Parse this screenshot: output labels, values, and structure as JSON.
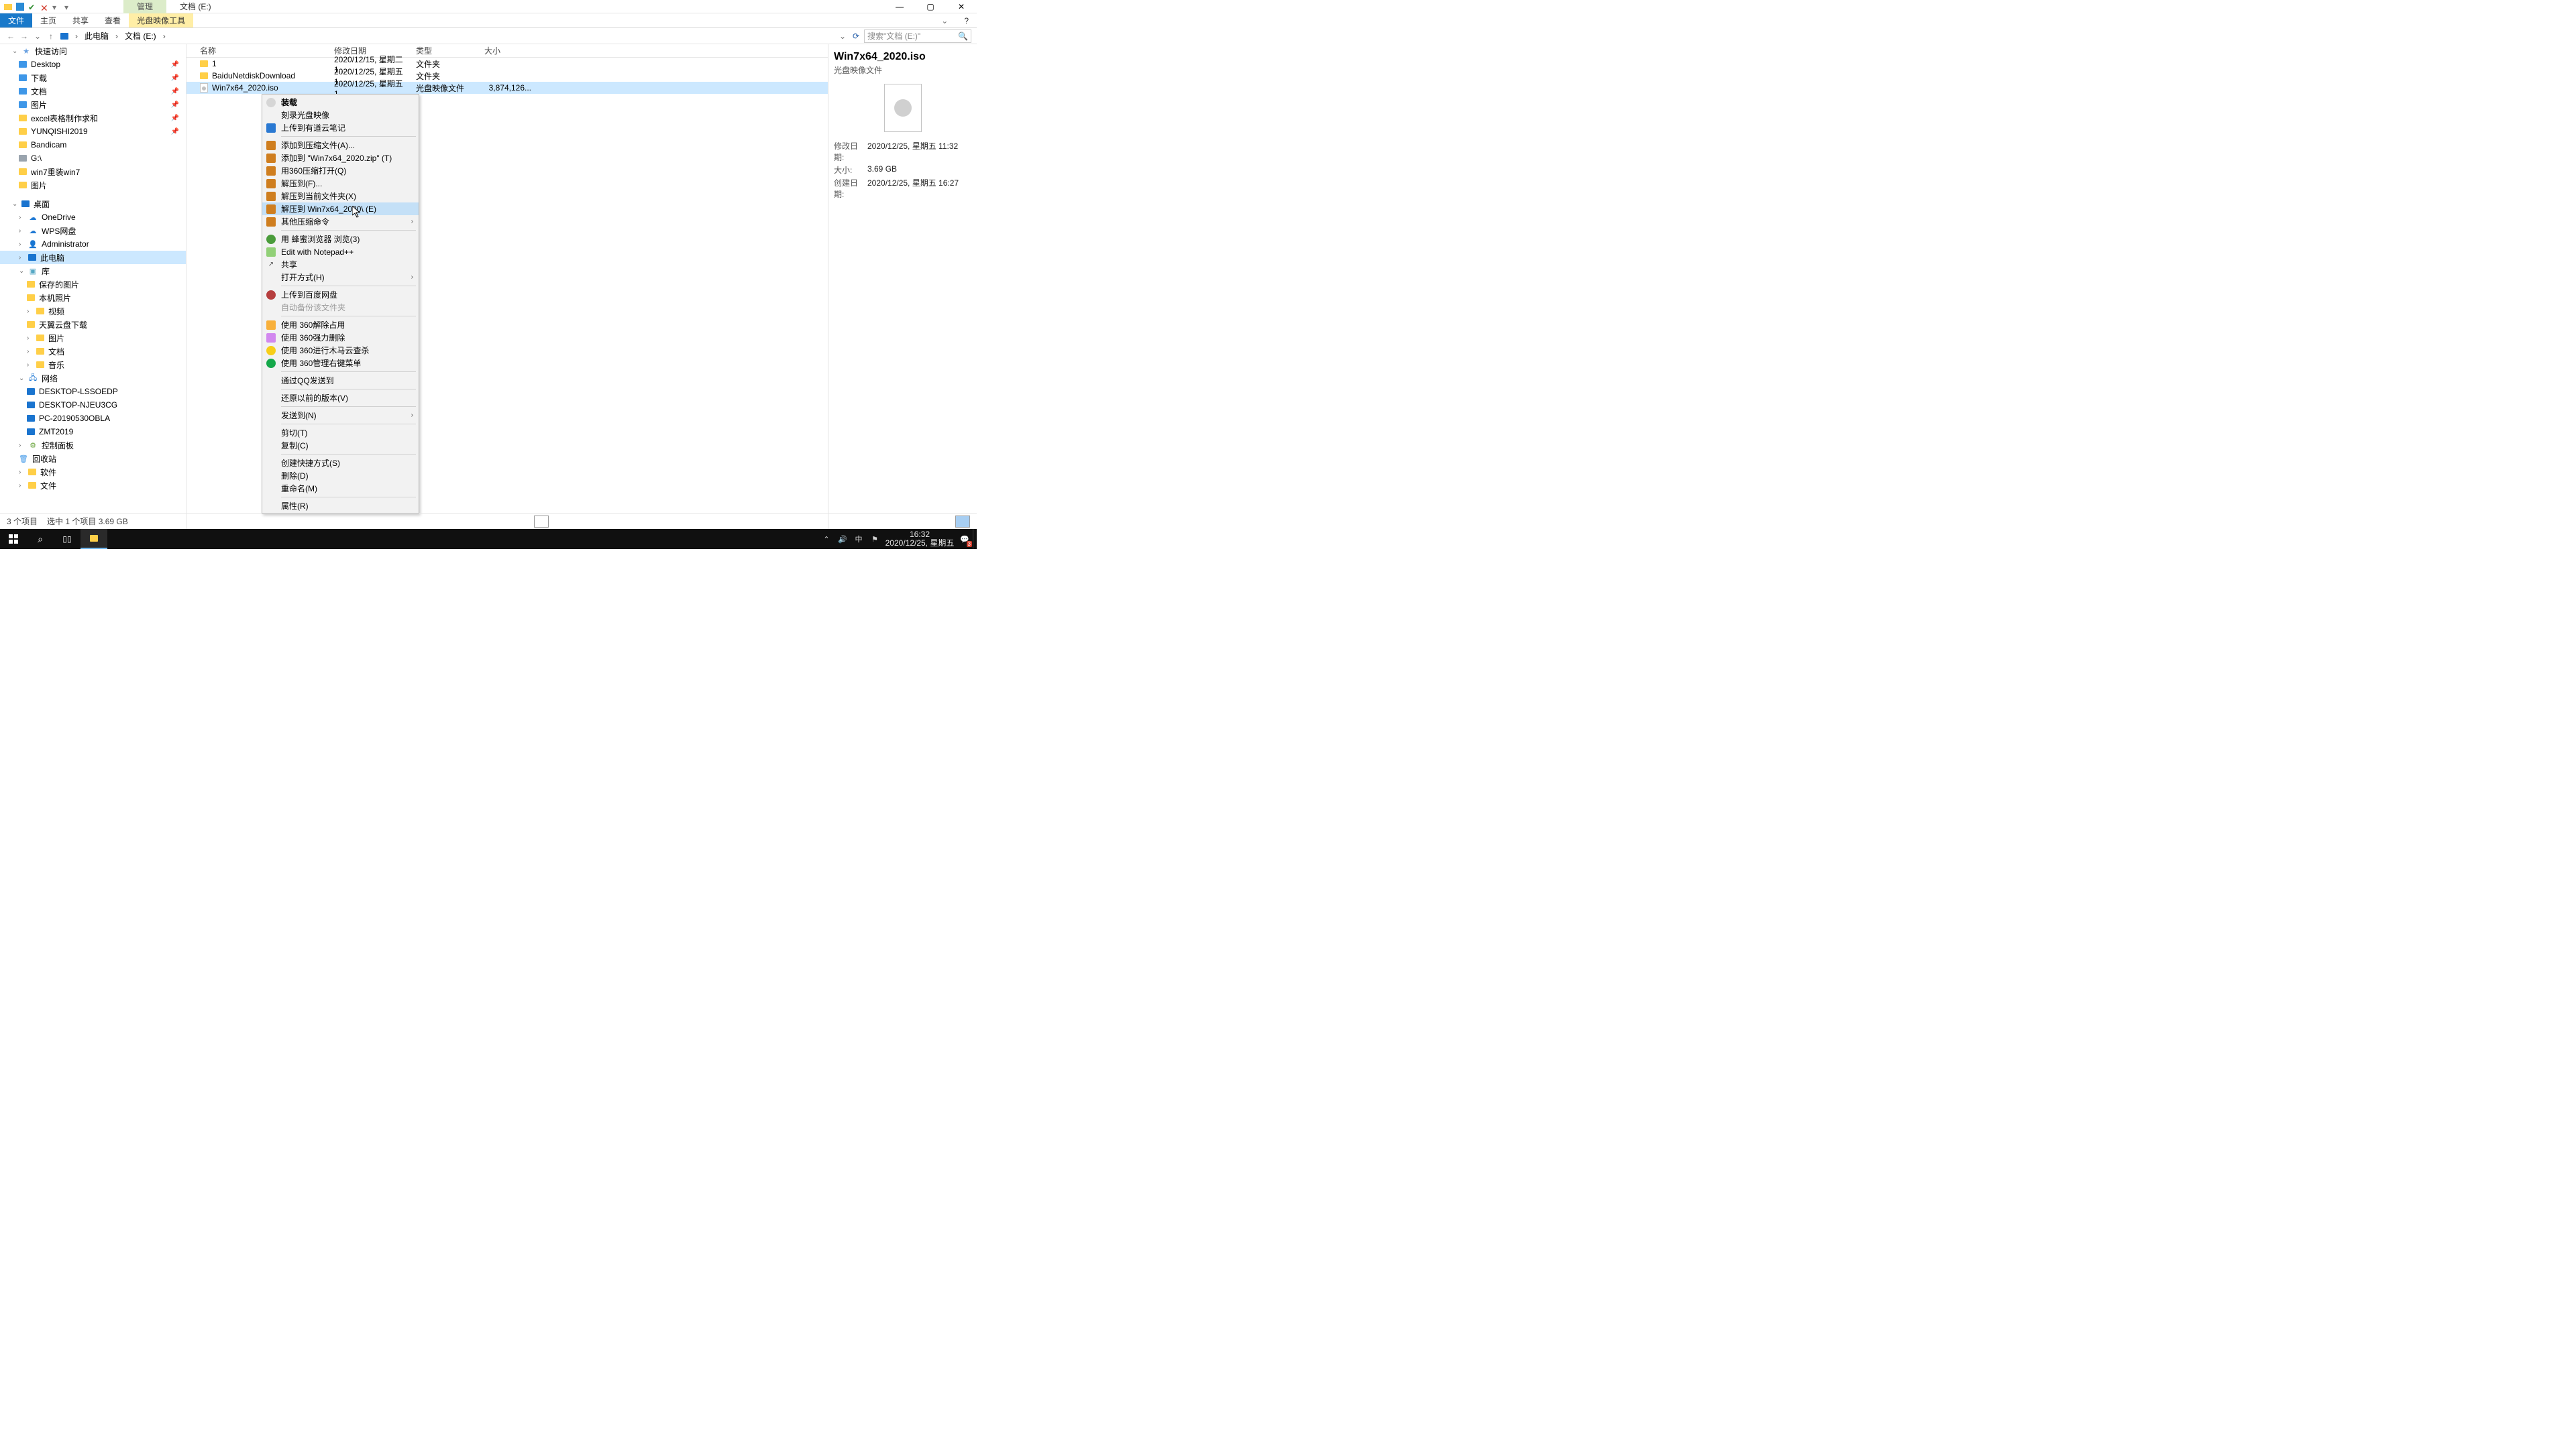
{
  "titlebar": {
    "contextual_tab": "管理",
    "window_title": "文档 (E:)"
  },
  "ribbon": {
    "file": "文件",
    "home": "主页",
    "share": "共享",
    "view": "查看",
    "ctx": "光盘映像工具"
  },
  "address": {
    "root": "此电脑",
    "path1": "文档 (E:)",
    "search_placeholder": "搜索\"文档 (E:)\""
  },
  "columns": {
    "name": "名称",
    "date": "修改日期",
    "type": "类型",
    "size": "大小"
  },
  "rows": [
    {
      "name": "1",
      "date": "2020/12/15, 星期二 1...",
      "type": "文件夹",
      "size": ""
    },
    {
      "name": "BaiduNetdiskDownload",
      "date": "2020/12/25, 星期五 1...",
      "type": "文件夹",
      "size": ""
    },
    {
      "name": "Win7x64_2020.iso",
      "date": "2020/12/25, 星期五 1...",
      "type": "光盘映像文件",
      "size": "3,874,126..."
    }
  ],
  "nav": {
    "quick": "快速访问",
    "desktop": "Desktop",
    "downloads": "下载",
    "docs": "文档",
    "pics": "图片",
    "excel": "excel表格制作求和",
    "yun": "YUNQISHI2019",
    "band": "Bandicam",
    "g": "G:\\",
    "w7": "win7重装win7",
    "pics2": "图片",
    "desk_cn": "桌面",
    "onedrive": "OneDrive",
    "wps": "WPS网盘",
    "admin": "Administrator",
    "thispc": "此电脑",
    "lib": "库",
    "saved": "保存的图片",
    "camera": "本机照片",
    "video": "视频",
    "tcloud": "天翼云盘下载",
    "libpic": "图片",
    "libdoc": "文档",
    "libmus": "音乐",
    "net": "网络",
    "n1": "DESKTOP-LSSOEDP",
    "n2": "DESKTOP-NJEU3CG",
    "n3": "PC-20190530OBLA",
    "n4": "ZMT2019",
    "cpanel": "控制面板",
    "recycle": "回收站",
    "soft": "软件",
    "files": "文件"
  },
  "status": {
    "count": "3 个项目",
    "sel": "选中 1 个项目  3.69 GB"
  },
  "prev": {
    "title": "Win7x64_2020.iso",
    "sub": "光盘映像文件",
    "k1": "修改日期:",
    "v1": "2020/12/25, 星期五 11:32",
    "k2": "大小:",
    "v2": "3.69 GB",
    "k3": "创建日期:",
    "v3": "2020/12/25, 星期五 16:27"
  },
  "menu": {
    "mount": "装载",
    "burn": "刻录光盘映像",
    "youdao": "上传到有道云笔记",
    "addarc": "添加到压缩文件(A)...",
    "addzip": "添加到 \"Win7x64_2020.zip\" (T)",
    "open360": "用360压缩打开(Q)",
    "extractto": "解压到(F)...",
    "extracthere": "解压到当前文件夹(X)",
    "extractname": "解压到 Win7x64_2020\\ (E)",
    "othercomp": "其他压缩命令",
    "bee": "用 蜂蜜浏览器 浏览(3)",
    "npp": "Edit with Notepad++",
    "share": "共享",
    "openwith": "打开方式(H)",
    "baidupan": "上传到百度网盘",
    "autobak": "自动备份该文件夹",
    "force1": "使用 360解除占用",
    "force2": "使用 360强力删除",
    "force3": "使用 360进行木马云查杀",
    "force4": "使用 360管理右键菜单",
    "qq": "通过QQ发送到",
    "restore": "还原以前的版本(V)",
    "sendto": "发送到(N)",
    "cut": "剪切(T)",
    "copy": "复制(C)",
    "shortcut": "创建快捷方式(S)",
    "delete": "删除(D)",
    "rename": "重命名(M)",
    "props": "属性(R)"
  },
  "tray": {
    "ime": "中",
    "time": "16:32",
    "date": "2020/12/25, 星期五",
    "badge": "3"
  }
}
